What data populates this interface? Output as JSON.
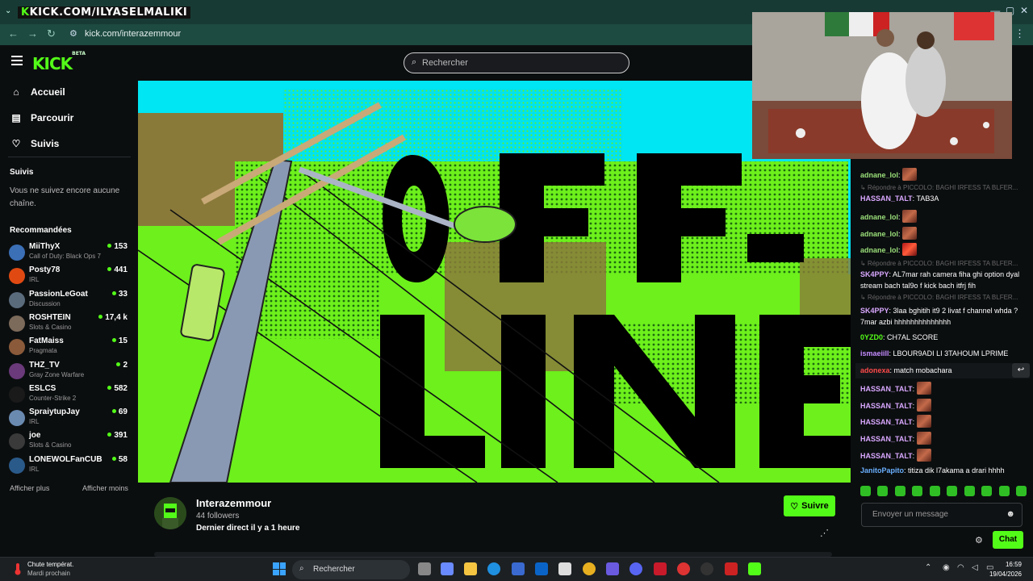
{
  "browser": {
    "tab_overlay_prefix": "K",
    "tab_overlay_text": "KICK.COM/ILYASELMALIKI",
    "url": "kick.com/interazemmour"
  },
  "header": {
    "logo": "KICK",
    "logo_badge": "BETA",
    "search_placeholder": "Rechercher"
  },
  "sidebar": {
    "nav": [
      {
        "label": "Accueil",
        "icon": "home-icon"
      },
      {
        "label": "Parcourir",
        "icon": "browse-icon"
      },
      {
        "label": "Suivis",
        "icon": "heart-icon"
      }
    ],
    "follows_title": "Suivis",
    "follows_empty": "Vous ne suivez encore aucune chaîne.",
    "recommended_title": "Recommandées",
    "recommended": [
      {
        "name": "MiiThyX",
        "category": "Call of Duty: Black Ops 7",
        "viewers": "153",
        "color": "#3b6fb6"
      },
      {
        "name": "Posty78",
        "category": "IRL",
        "viewers": "441",
        "color": "#e04a12"
      },
      {
        "name": "PassionLeGoat",
        "category": "Discussion",
        "viewers": "33",
        "color": "#5a6b7c"
      },
      {
        "name": "ROSHTEIN",
        "category": "Slots & Casino",
        "viewers": "17,4 k",
        "color": "#7c6a5a"
      },
      {
        "name": "FatMaiss",
        "category": "Pragmata",
        "viewers": "15",
        "color": "#8a5a3a"
      },
      {
        "name": "THZ_TV",
        "category": "Gray Zone Warfare",
        "viewers": "2",
        "color": "#6a3a7a"
      },
      {
        "name": "ESLCS",
        "category": "Counter-Strike 2",
        "viewers": "582",
        "color": "#1a1a1a"
      },
      {
        "name": "SpraiytupJay",
        "category": "IRL",
        "viewers": "69",
        "color": "#6a8ab0"
      },
      {
        "name": "joe",
        "category": "Slots & Casino",
        "viewers": "391",
        "color": "#3a3a3a"
      },
      {
        "name": "LONEWOLFanCUB",
        "category": "IRL",
        "viewers": "58",
        "color": "#2a5a8a"
      }
    ],
    "show_more": "Afficher plus",
    "show_less": "Afficher moins"
  },
  "channel": {
    "name": "Interazemmour",
    "followers": "44 followers",
    "last_live": "Dernier direct il y a 1 heure",
    "follow_label": "Suivre"
  },
  "chat": {
    "messages": [
      {
        "user": "adnane_lol",
        "color": "#9be07a",
        "text": "",
        "emote": "plain"
      },
      {
        "reply": "Répondre à PICCOLO: BAGHI IRFESS TA BLFER..."
      },
      {
        "user": "HASSAN_TALT",
        "color": "#d9a8ff",
        "text": "TAB3A"
      },
      {
        "user": "adnane_lol",
        "color": "#9be07a",
        "text": "",
        "emote": "plain"
      },
      {
        "user": "adnane_lol",
        "color": "#9be07a",
        "text": "",
        "emote": "plain"
      },
      {
        "user": "adnane_lol",
        "color": "#9be07a",
        "text": "",
        "emote": "red"
      },
      {
        "reply": "Répondre à PICCOLO: BAGHI IRFESS TA BLFER..."
      },
      {
        "user": "SK4PPY",
        "color": "#d9a8ff",
        "text": "AL7mar rah camera fiha ghi option dyal stream bach tal9o f kick bach itfrj fih"
      },
      {
        "reply": "Répondre à PICCOLO: BAGHI IRFESS TA BLFER..."
      },
      {
        "user": "SK4PPY",
        "color": "#d9a8ff",
        "text": "3laa bghitih it9 2 livat f channel whda ? 7mar azbi hhhhhhhhhhhhhh"
      },
      {
        "user": "0YZD0",
        "color": "#53fc18",
        "text": "CH7AL SCORE"
      },
      {
        "user": "ismaeiill",
        "color": "#c58cff",
        "text": "LBOUR9ADI LI 3TAHOUM LPRIME"
      },
      {
        "user": "adonexa",
        "color": "#ff4a4a",
        "text": "match mobachara"
      },
      {
        "user": "HASSAN_TALT",
        "color": "#d9a8ff",
        "text": "",
        "emote": "plain"
      },
      {
        "user": "HASSAN_TALT",
        "color": "#d9a8ff",
        "text": "",
        "emote": "plain"
      },
      {
        "user": "HASSAN_TALT",
        "color": "#d9a8ff",
        "text": "",
        "emote": "plain"
      },
      {
        "user": "HASSAN_TALT",
        "color": "#d9a8ff",
        "text": "",
        "emote": "plain"
      },
      {
        "user": "HASSAN_TALT",
        "color": "#d9a8ff",
        "text": "",
        "emote": "plain"
      },
      {
        "user": "JanitoPapito",
        "color": "#6ab0ff",
        "text": "titiza dik l7akama a drari hhhh"
      }
    ],
    "input_placeholder": "Envoyer un message",
    "send_label": "Chat"
  },
  "taskbar": {
    "weather_title": "Chute températ.",
    "weather_sub": "Mardi prochain",
    "search": "Rechercher",
    "time": "16:59",
    "date": "19/04/2026"
  },
  "colors": {
    "accent": "#53fc18",
    "background": "#0b0e0f"
  }
}
